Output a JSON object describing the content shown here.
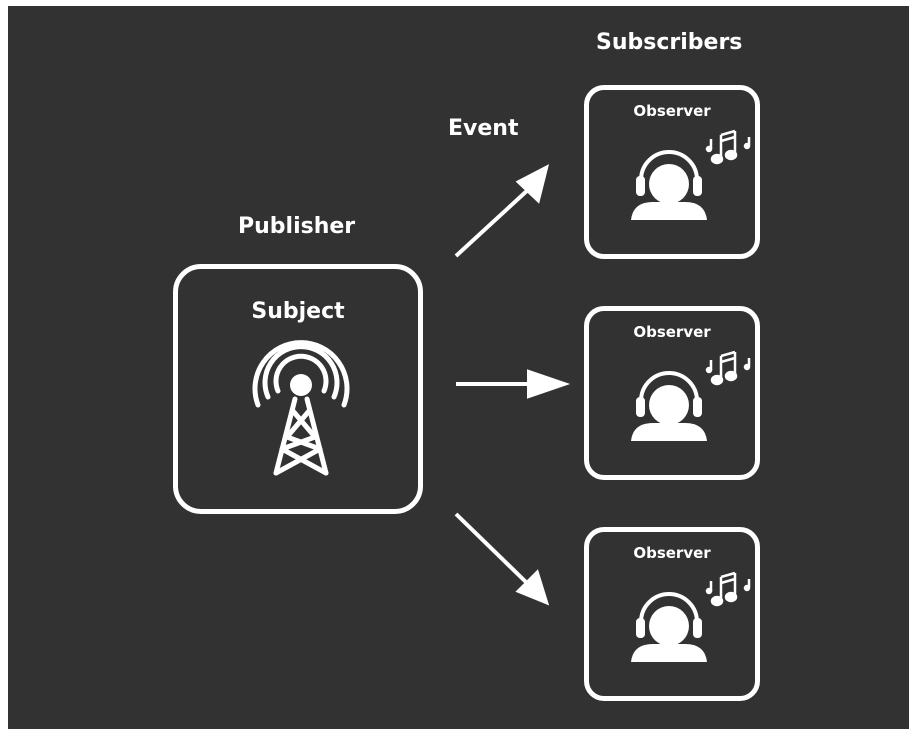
{
  "diagram": {
    "subscribers_label": "Subscribers",
    "event_label": "Event",
    "publisher_label": "Publisher",
    "subject": {
      "title": "Subject",
      "icon": "radio-tower-icon"
    },
    "observers": [
      {
        "title": "Observer",
        "icon": "listener-headphones-icon",
        "notes_icon": "music-notes-icon"
      },
      {
        "title": "Observer",
        "icon": "listener-headphones-icon",
        "notes_icon": "music-notes-icon"
      },
      {
        "title": "Observer",
        "icon": "listener-headphones-icon",
        "notes_icon": "music-notes-icon"
      }
    ],
    "colors": {
      "background": "#323232",
      "foreground": "#ffffff"
    }
  }
}
